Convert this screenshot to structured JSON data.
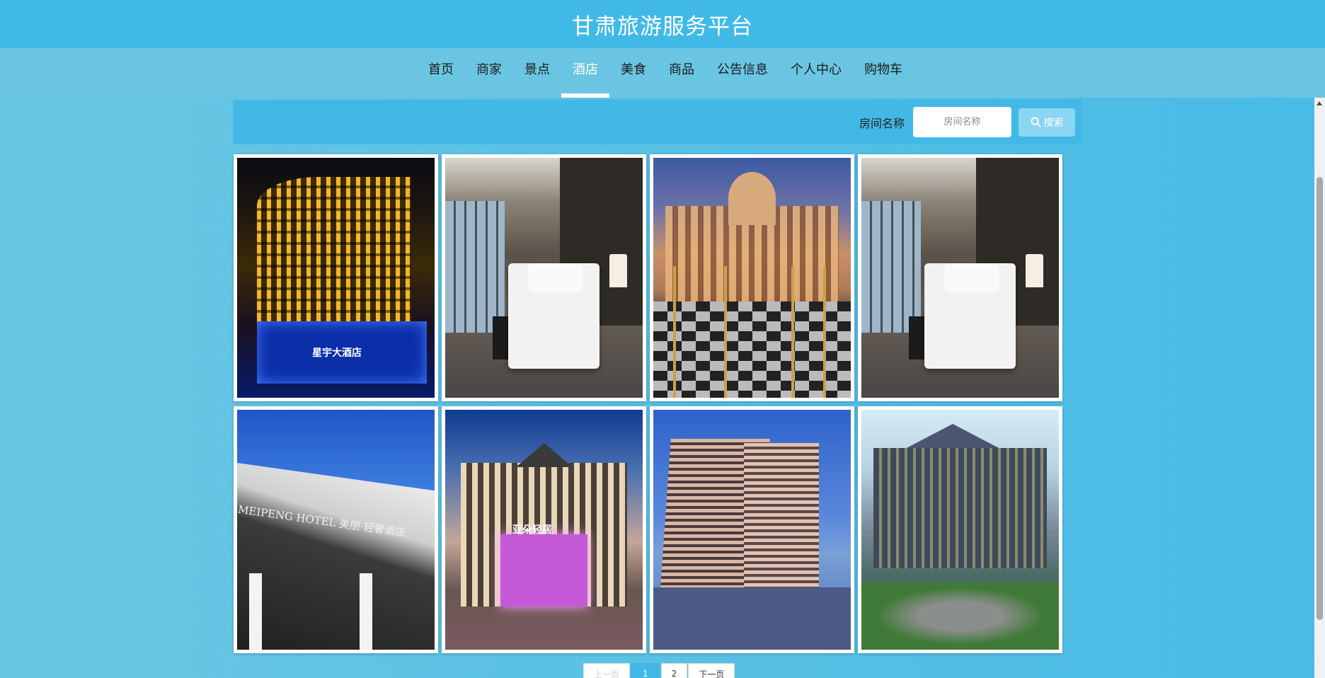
{
  "header": {
    "title": "甘肃旅游服务平台"
  },
  "nav": {
    "items": [
      {
        "label": "首页",
        "active": false
      },
      {
        "label": "商家",
        "active": false
      },
      {
        "label": "景点",
        "active": false
      },
      {
        "label": "酒店",
        "active": true
      },
      {
        "label": "美食",
        "active": false
      },
      {
        "label": "商品",
        "active": false
      },
      {
        "label": "公告信息",
        "active": false
      },
      {
        "label": "个人中心",
        "active": false
      },
      {
        "label": "购物车",
        "active": false
      }
    ]
  },
  "search": {
    "label": "房间名称",
    "placeholder": "房间名称",
    "value": "",
    "button_label": "搜索"
  },
  "hotels": [
    {
      "image": "night-hotel-building",
      "sign": "星宇大酒店"
    },
    {
      "image": "hotel-room"
    },
    {
      "image": "palace-hotel-courtyard"
    },
    {
      "image": "hotel-room"
    },
    {
      "image": "meipeng-hotel-facade",
      "sign": "MEIPENG HOTEL 美朋·轻奢酒店"
    },
    {
      "image": "yaduo-hotel-facade",
      "sign": "亚朵轻居"
    },
    {
      "image": "tall-hotel-building"
    },
    {
      "image": "thai-style-hotel"
    }
  ],
  "pagination": {
    "prev_label": "上一页",
    "pages": [
      "1",
      "2"
    ],
    "current_page": "1",
    "next_label": "下一页"
  },
  "colors": {
    "header_bg": "#41b9e6",
    "nav_bg": "#6ac5e3",
    "search_button": "#89d6f2",
    "page_bg": "#58c1e4"
  }
}
